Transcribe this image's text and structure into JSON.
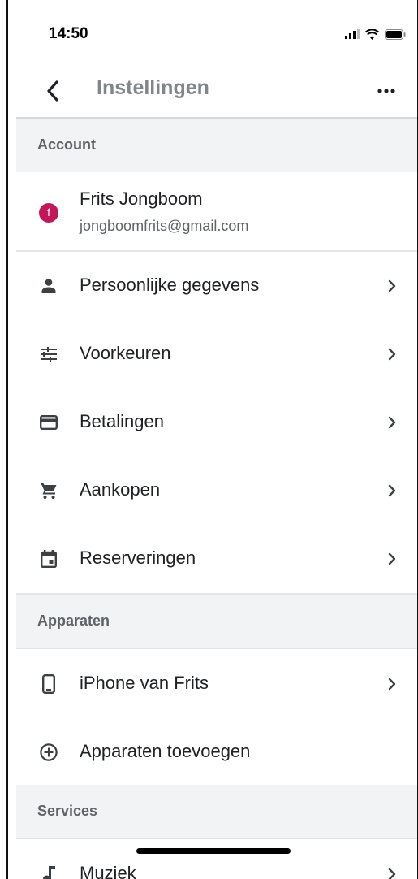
{
  "status_bar": {
    "time": "14:50"
  },
  "header": {
    "title": "Instellingen"
  },
  "sections": {
    "account": {
      "title": "Account"
    },
    "devices": {
      "title": "Apparaten"
    },
    "services": {
      "title": "Services"
    }
  },
  "account": {
    "avatar_letter": "f",
    "name": "Frits Jongboom",
    "email": "jongboomfrits@gmail.com",
    "avatar_color": "#c2185b"
  },
  "menu": {
    "personal_info": "Persoonlijke gegevens",
    "preferences": "Voorkeuren",
    "payments": "Betalingen",
    "purchases": "Aankopen",
    "reservations": "Reserveringen"
  },
  "devices": {
    "iphone": "iPhone van Frits",
    "add": "Apparaten toevoegen"
  },
  "services": {
    "music": "Muziek"
  },
  "colors": {
    "section_bg": "#f1f3f4",
    "title_gray": "#80868b",
    "text": "#202124"
  }
}
